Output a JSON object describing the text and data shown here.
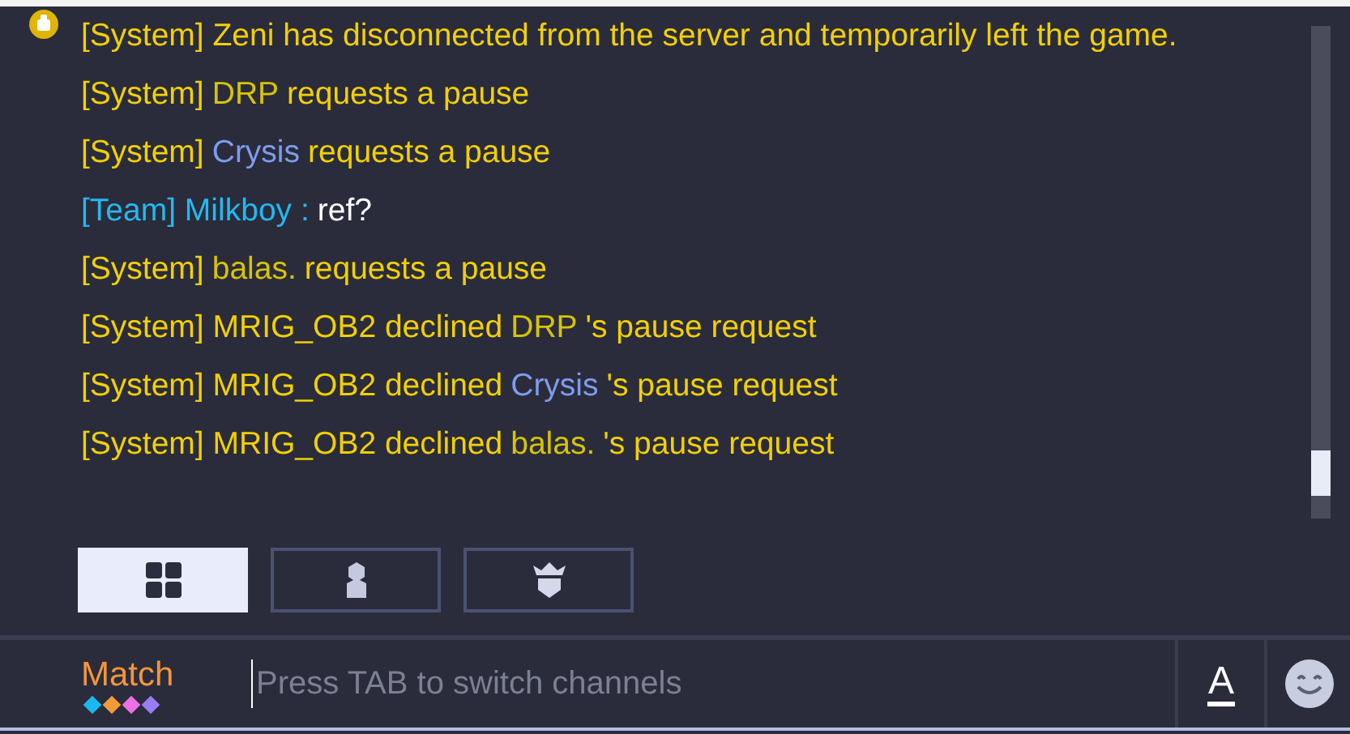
{
  "messages": [
    {
      "segments": [
        {
          "text": "[System] Zeni has disconnected from the server and temporarily left the game.",
          "color": "#f2d000"
        }
      ],
      "icon": true
    },
    {
      "segments": [
        {
          "text": "[System]",
          "color": "#f2d000"
        },
        {
          "text": "DRP",
          "color": "#d8c400"
        },
        {
          "text": "requests a pause",
          "color": "#f2d000"
        }
      ],
      "icon": false
    },
    {
      "segments": [
        {
          "text": "[System]",
          "color": "#f2d000"
        },
        {
          "text": "Crysis",
          "color": "#7f9bef"
        },
        {
          "text": "requests a pause",
          "color": "#f2d000"
        }
      ],
      "icon": false
    },
    {
      "segments": [
        {
          "text": "[Team] Milkboy :",
          "color": "#25b8f0"
        },
        {
          "text": "ref?",
          "color": "#ffffff"
        }
      ],
      "icon": false
    },
    {
      "segments": [
        {
          "text": "[System]",
          "color": "#f2d000"
        },
        {
          "text": "balas.",
          "color": "#d8c400"
        },
        {
          "text": "requests a pause",
          "color": "#f2d000"
        }
      ],
      "icon": false
    },
    {
      "segments": [
        {
          "text": "[System] MRIG_OB2 declined",
          "color": "#f2d000"
        },
        {
          "text": "DRP",
          "color": "#d8c400"
        },
        {
          "text": "'s pause request",
          "color": "#f2d000"
        }
      ],
      "icon": false
    },
    {
      "segments": [
        {
          "text": "[System] MRIG_OB2 declined",
          "color": "#f2d000"
        },
        {
          "text": "Crysis",
          "color": "#7f9bef"
        },
        {
          "text": "'s pause request",
          "color": "#f2d000"
        }
      ],
      "icon": false
    },
    {
      "segments": [
        {
          "text": "[System] MRIG_OB2 declined",
          "color": "#f2d000"
        },
        {
          "text": "balas.",
          "color": "#d8c400"
        },
        {
          "text": "'s pause request",
          "color": "#f2d000"
        }
      ],
      "icon": false
    }
  ],
  "filter_tabs": [
    {
      "kind": "all",
      "selected": true
    },
    {
      "kind": "person",
      "selected": false
    },
    {
      "kind": "guild",
      "selected": false
    }
  ],
  "channel": {
    "label": "Match",
    "dots": [
      {
        "color": "#1ab8f0"
      },
      {
        "color": "#f59a3a"
      },
      {
        "color": "#ee6ee8"
      },
      {
        "color": "#9a7cf5"
      }
    ]
  },
  "input": {
    "placeholder": "Press TAB to switch channels"
  },
  "font_button": {
    "label": "A"
  }
}
